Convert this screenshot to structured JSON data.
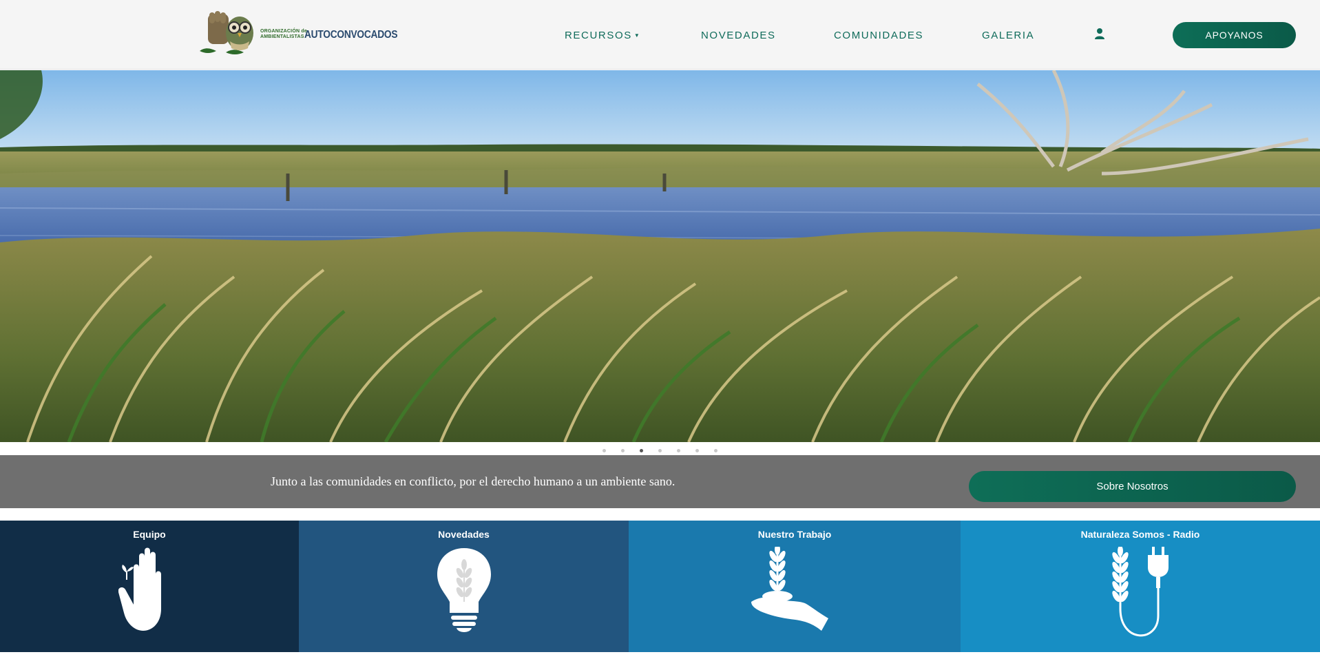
{
  "header": {
    "logo": {
      "small_line1": "ORGANIZACIÓN de",
      "small_line2": "AMBIENTALISTAS",
      "big": "AUTOCONVOCADOS"
    },
    "nav": [
      {
        "label": "RECURSOS",
        "has_dropdown": true
      },
      {
        "label": "NOVEDADES"
      },
      {
        "label": "COMUNIDADES"
      },
      {
        "label": "GALERIA"
      }
    ],
    "user_icon": "user-icon",
    "support_button": "APOYANOS"
  },
  "hero": {
    "slide_count": 7,
    "active_slide_index": 2
  },
  "band": {
    "tagline": "Junto a las comunidades en conflicto, por el derecho humano a un ambiente sano.",
    "about_button": "Sobre Nosotros"
  },
  "tiles": [
    {
      "title": "Equipo",
      "icon": "hand-sprout-icon",
      "color": "#112d47"
    },
    {
      "title": "Novedades",
      "icon": "lightbulb-icon",
      "color": "#22557f"
    },
    {
      "title": "Nuestro Trabajo",
      "icon": "hand-plant-icon",
      "color": "#1a79ad"
    },
    {
      "title": "Naturaleza Somos - Radio",
      "icon": "plant-plug-icon",
      "color": "#178ec4"
    }
  ],
  "colors": {
    "brand_green": "#0d6e57",
    "band_gray": "#6f6f6f",
    "header_bg": "#f5f5f5"
  }
}
